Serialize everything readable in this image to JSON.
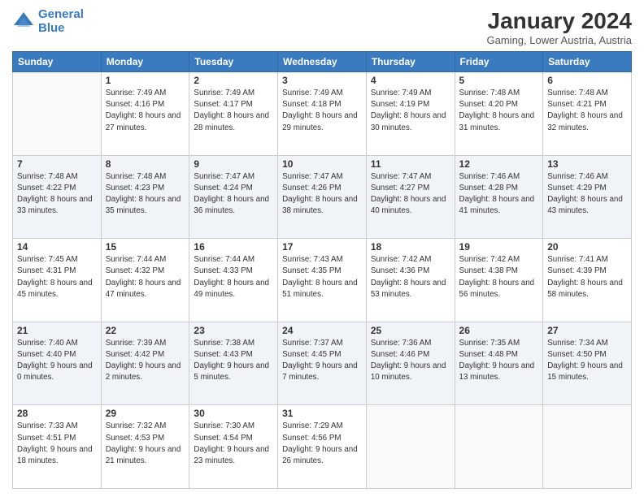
{
  "logo": {
    "line1": "General",
    "line2": "Blue"
  },
  "title": "January 2024",
  "subtitle": "Gaming, Lower Austria, Austria",
  "weekdays": [
    "Sunday",
    "Monday",
    "Tuesday",
    "Wednesday",
    "Thursday",
    "Friday",
    "Saturday"
  ],
  "weeks": [
    [
      {
        "day": "",
        "empty": true
      },
      {
        "day": "1",
        "sunrise": "Sunrise: 7:49 AM",
        "sunset": "Sunset: 4:16 PM",
        "daylight": "Daylight: 8 hours and 27 minutes."
      },
      {
        "day": "2",
        "sunrise": "Sunrise: 7:49 AM",
        "sunset": "Sunset: 4:17 PM",
        "daylight": "Daylight: 8 hours and 28 minutes."
      },
      {
        "day": "3",
        "sunrise": "Sunrise: 7:49 AM",
        "sunset": "Sunset: 4:18 PM",
        "daylight": "Daylight: 8 hours and 29 minutes."
      },
      {
        "day": "4",
        "sunrise": "Sunrise: 7:49 AM",
        "sunset": "Sunset: 4:19 PM",
        "daylight": "Daylight: 8 hours and 30 minutes."
      },
      {
        "day": "5",
        "sunrise": "Sunrise: 7:48 AM",
        "sunset": "Sunset: 4:20 PM",
        "daylight": "Daylight: 8 hours and 31 minutes."
      },
      {
        "day": "6",
        "sunrise": "Sunrise: 7:48 AM",
        "sunset": "Sunset: 4:21 PM",
        "daylight": "Daylight: 8 hours and 32 minutes."
      }
    ],
    [
      {
        "day": "7",
        "sunrise": "Sunrise: 7:48 AM",
        "sunset": "Sunset: 4:22 PM",
        "daylight": "Daylight: 8 hours and 33 minutes."
      },
      {
        "day": "8",
        "sunrise": "Sunrise: 7:48 AM",
        "sunset": "Sunset: 4:23 PM",
        "daylight": "Daylight: 8 hours and 35 minutes."
      },
      {
        "day": "9",
        "sunrise": "Sunrise: 7:47 AM",
        "sunset": "Sunset: 4:24 PM",
        "daylight": "Daylight: 8 hours and 36 minutes."
      },
      {
        "day": "10",
        "sunrise": "Sunrise: 7:47 AM",
        "sunset": "Sunset: 4:26 PM",
        "daylight": "Daylight: 8 hours and 38 minutes."
      },
      {
        "day": "11",
        "sunrise": "Sunrise: 7:47 AM",
        "sunset": "Sunset: 4:27 PM",
        "daylight": "Daylight: 8 hours and 40 minutes."
      },
      {
        "day": "12",
        "sunrise": "Sunrise: 7:46 AM",
        "sunset": "Sunset: 4:28 PM",
        "daylight": "Daylight: 8 hours and 41 minutes."
      },
      {
        "day": "13",
        "sunrise": "Sunrise: 7:46 AM",
        "sunset": "Sunset: 4:29 PM",
        "daylight": "Daylight: 8 hours and 43 minutes."
      }
    ],
    [
      {
        "day": "14",
        "sunrise": "Sunrise: 7:45 AM",
        "sunset": "Sunset: 4:31 PM",
        "daylight": "Daylight: 8 hours and 45 minutes."
      },
      {
        "day": "15",
        "sunrise": "Sunrise: 7:44 AM",
        "sunset": "Sunset: 4:32 PM",
        "daylight": "Daylight: 8 hours and 47 minutes."
      },
      {
        "day": "16",
        "sunrise": "Sunrise: 7:44 AM",
        "sunset": "Sunset: 4:33 PM",
        "daylight": "Daylight: 8 hours and 49 minutes."
      },
      {
        "day": "17",
        "sunrise": "Sunrise: 7:43 AM",
        "sunset": "Sunset: 4:35 PM",
        "daylight": "Daylight: 8 hours and 51 minutes."
      },
      {
        "day": "18",
        "sunrise": "Sunrise: 7:42 AM",
        "sunset": "Sunset: 4:36 PM",
        "daylight": "Daylight: 8 hours and 53 minutes."
      },
      {
        "day": "19",
        "sunrise": "Sunrise: 7:42 AM",
        "sunset": "Sunset: 4:38 PM",
        "daylight": "Daylight: 8 hours and 56 minutes."
      },
      {
        "day": "20",
        "sunrise": "Sunrise: 7:41 AM",
        "sunset": "Sunset: 4:39 PM",
        "daylight": "Daylight: 8 hours and 58 minutes."
      }
    ],
    [
      {
        "day": "21",
        "sunrise": "Sunrise: 7:40 AM",
        "sunset": "Sunset: 4:40 PM",
        "daylight": "Daylight: 9 hours and 0 minutes."
      },
      {
        "day": "22",
        "sunrise": "Sunrise: 7:39 AM",
        "sunset": "Sunset: 4:42 PM",
        "daylight": "Daylight: 9 hours and 2 minutes."
      },
      {
        "day": "23",
        "sunrise": "Sunrise: 7:38 AM",
        "sunset": "Sunset: 4:43 PM",
        "daylight": "Daylight: 9 hours and 5 minutes."
      },
      {
        "day": "24",
        "sunrise": "Sunrise: 7:37 AM",
        "sunset": "Sunset: 4:45 PM",
        "daylight": "Daylight: 9 hours and 7 minutes."
      },
      {
        "day": "25",
        "sunrise": "Sunrise: 7:36 AM",
        "sunset": "Sunset: 4:46 PM",
        "daylight": "Daylight: 9 hours and 10 minutes."
      },
      {
        "day": "26",
        "sunrise": "Sunrise: 7:35 AM",
        "sunset": "Sunset: 4:48 PM",
        "daylight": "Daylight: 9 hours and 13 minutes."
      },
      {
        "day": "27",
        "sunrise": "Sunrise: 7:34 AM",
        "sunset": "Sunset: 4:50 PM",
        "daylight": "Daylight: 9 hours and 15 minutes."
      }
    ],
    [
      {
        "day": "28",
        "sunrise": "Sunrise: 7:33 AM",
        "sunset": "Sunset: 4:51 PM",
        "daylight": "Daylight: 9 hours and 18 minutes."
      },
      {
        "day": "29",
        "sunrise": "Sunrise: 7:32 AM",
        "sunset": "Sunset: 4:53 PM",
        "daylight": "Daylight: 9 hours and 21 minutes."
      },
      {
        "day": "30",
        "sunrise": "Sunrise: 7:30 AM",
        "sunset": "Sunset: 4:54 PM",
        "daylight": "Daylight: 9 hours and 23 minutes."
      },
      {
        "day": "31",
        "sunrise": "Sunrise: 7:29 AM",
        "sunset": "Sunset: 4:56 PM",
        "daylight": "Daylight: 9 hours and 26 minutes."
      },
      {
        "day": "",
        "empty": true
      },
      {
        "day": "",
        "empty": true
      },
      {
        "day": "",
        "empty": true
      }
    ]
  ]
}
